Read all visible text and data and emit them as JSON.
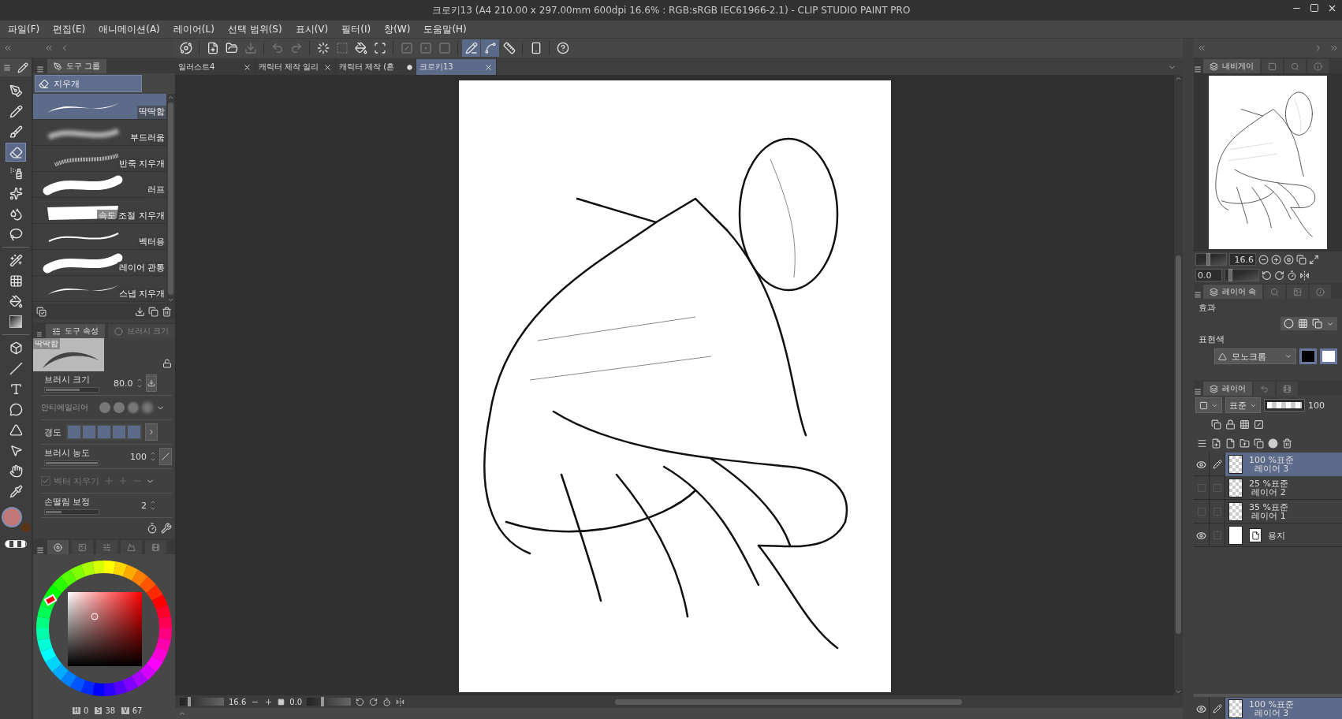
{
  "window": {
    "title": "크로키13 (A4 210.00 x 297.00mm 600dpi 16.6% : RGB:sRGB IEC61966-2.1)  - CLIP STUDIO PAINT PRO"
  },
  "menu": [
    "파일(F)",
    "편집(E)",
    "애니메이션(A)",
    "레이어(L)",
    "선택 범위(S)",
    "표시(V)",
    "필터(I)",
    "창(W)",
    "도움말(H)"
  ],
  "toolbar": [
    {
      "kind": "app",
      "disabled": false,
      "selected": false
    },
    {
      "kind": "new",
      "disabled": false,
      "selected": false
    },
    {
      "kind": "open",
      "disabled": false,
      "selected": false
    },
    {
      "kind": "save",
      "disabled": true,
      "selected": false
    },
    {
      "kind": "undo",
      "disabled": true,
      "selected": false
    },
    {
      "kind": "redo",
      "disabled": true,
      "selected": false
    },
    {
      "kind": "clear",
      "disabled": false,
      "selected": false
    },
    {
      "kind": "outside",
      "disabled": true,
      "selected": false
    },
    {
      "kind": "fill",
      "disabled": false,
      "selected": false
    },
    {
      "kind": "transform",
      "disabled": false,
      "selected": false
    },
    {
      "kind": "hide",
      "disabled": true,
      "selected": false
    },
    {
      "kind": "invert",
      "disabled": true,
      "selected": false
    },
    {
      "kind": "border",
      "disabled": true,
      "selected": false
    },
    {
      "kind": "snap_ruler",
      "disabled": false,
      "selected": true
    },
    {
      "kind": "snap_special",
      "disabled": false,
      "selected": true
    },
    {
      "kind": "snap_grid",
      "disabled": false,
      "selected": false
    },
    {
      "kind": "device",
      "disabled": false,
      "selected": false
    },
    {
      "kind": "help",
      "disabled": false,
      "selected": false
    }
  ],
  "document_tabs": [
    {
      "label": "일러스트4",
      "selected": false,
      "modified": false
    },
    {
      "label": "캐릭터 제작 일리",
      "selected": false,
      "modified": false
    },
    {
      "label": "캐릭터 제작 (혼",
      "selected": false,
      "modified": true
    },
    {
      "label": "크로키13",
      "selected": true,
      "modified": false
    }
  ],
  "tools": [
    {
      "kind": "pen",
      "selected": false
    },
    {
      "kind": "pencil",
      "selected": false
    },
    {
      "kind": "brush",
      "selected": false
    },
    {
      "kind": "eraser",
      "selected": true
    },
    {
      "kind": "airbrush",
      "selected": false
    },
    {
      "kind": "decoration",
      "selected": false
    },
    {
      "kind": "blend",
      "selected": false
    },
    {
      "kind": "lasso",
      "selected": false
    },
    {
      "kind": "wand",
      "selected": false
    },
    {
      "kind": "grid",
      "selected": false
    },
    {
      "kind": "fill",
      "selected": false
    },
    {
      "kind": "gradient",
      "selected": false
    },
    {
      "kind": "object",
      "selected": false
    },
    {
      "kind": "line",
      "selected": false
    },
    {
      "kind": "text",
      "selected": false
    },
    {
      "kind": "balloon",
      "selected": false
    },
    {
      "kind": "ruler",
      "selected": false
    },
    {
      "kind": "correct",
      "selected": false
    },
    {
      "kind": "hand",
      "selected": false
    },
    {
      "kind": "eyedropper",
      "selected": false
    }
  ],
  "swatches": [
    {
      "kind": "main",
      "color": "#c07878"
    },
    {
      "kind": "sub",
      "color": "#5b3418"
    }
  ],
  "sub_tool": {
    "tabs": [
      {
        "kind": "tool_group",
        "label": "도구 그룹",
        "selected": true
      }
    ],
    "group": "지우개",
    "brushes": [
      {
        "label": "딱딱함",
        "kind": "taper",
        "selected": true
      },
      {
        "label": "부드러움",
        "kind": "soft",
        "selected": false
      },
      {
        "label": "반죽 지우개",
        "kind": "spray",
        "selected": false
      },
      {
        "label": "러프",
        "kind": "thick",
        "selected": false
      },
      {
        "label": "속도 조절 지우개",
        "kind": "blob",
        "selected": false
      },
      {
        "label": "벡터용",
        "kind": "thin",
        "selected": false
      },
      {
        "label": "레이어 관통",
        "kind": "thick",
        "selected": false
      },
      {
        "label": "스냅 지우개",
        "kind": "taper",
        "selected": false
      }
    ]
  },
  "tool_property": {
    "tabs": [
      {
        "kind": "tool_property",
        "label": "도구 속성",
        "selected": true
      },
      {
        "kind": "brush_size",
        "label": "브러시 크기",
        "selected": false
      }
    ],
    "preview": "딱딱함",
    "items": [
      {
        "kind": "slider",
        "label": "브러시 크기",
        "value": "80.0",
        "level": 0.65,
        "disabled": false
      },
      {
        "kind": "antialias",
        "label": "안티에일리어",
        "disabled": true
      },
      {
        "kind": "hardness",
        "label": "경도",
        "level": 1,
        "disabled": false
      },
      {
        "kind": "slider",
        "label": "브러시 농도",
        "value": "100",
        "level": 1,
        "disabled": false
      },
      {
        "kind": "check",
        "label": "벡터 지우기",
        "checked": true,
        "disabled": true
      },
      {
        "kind": "slider",
        "label": "손떨림 보정",
        "value": "2",
        "level": 0.3,
        "disabled": false
      }
    ]
  },
  "color_panel": {
    "tabs": [
      {
        "kind": "wheel",
        "selected": true
      },
      {
        "kind": "set",
        "selected": false
      },
      {
        "kind": "sliders",
        "selected": false
      },
      {
        "kind": "mountain",
        "selected": false
      },
      {
        "kind": "film",
        "selected": false
      }
    ],
    "hsv": [
      {
        "label": "H",
        "value": "0"
      },
      {
        "label": "S",
        "value": "38"
      },
      {
        "label": "V",
        "value": "67"
      }
    ]
  },
  "navigator": {
    "tabs": [
      {
        "kind": "navigator",
        "label": "내비게이",
        "selected": true
      },
      {
        "kind": "subview",
        "selected": false
      },
      {
        "kind": "search",
        "selected": false
      },
      {
        "kind": "info",
        "selected": false
      }
    ],
    "sliders": [
      {
        "kind": "zoom",
        "value": "16.6",
        "level": 0.38
      },
      {
        "kind": "rotate",
        "value": "0.0",
        "level": 0.1
      }
    ]
  },
  "layer_property": {
    "tabs": [
      {
        "kind": "layer_property",
        "label": "레이어 속",
        "selected": true
      },
      {
        "kind": "search",
        "selected": false
      },
      {
        "kind": "material",
        "selected": false
      },
      {
        "kind": "info",
        "selected": false
      }
    ],
    "effect": "효과",
    "expression": "표현색",
    "mode": "모노크롬"
  },
  "layer_panel": {
    "tabs": [
      {
        "kind": "layer",
        "label": "레이어",
        "selected": true
      },
      {
        "kind": "history",
        "selected": false
      },
      {
        "kind": "animation",
        "selected": false
      }
    ],
    "blend": "표준",
    "opacity": {
      "value": "100",
      "level": 1
    },
    "layers": [
      {
        "kind": "raster",
        "mode": "100 %표준",
        "name": "레이어 3",
        "visible": true,
        "editing": true,
        "selected": true
      },
      {
        "kind": "raster",
        "mode": "25 %표준",
        "name": "레이어 2",
        "visible": false,
        "editing": false,
        "selected": false
      },
      {
        "kind": "raster",
        "mode": "35 %표준",
        "name": "레이어 1",
        "visible": false,
        "editing": false,
        "selected": false
      },
      {
        "kind": "paper",
        "name": "용지",
        "visible": true,
        "editing": false,
        "selected": false
      }
    ],
    "footer": {
      "mode": "100 %표준",
      "name": "레이어 3"
    }
  },
  "status_bar": {
    "zoom": {
      "value": "16.6",
      "level": 0.2
    },
    "rotation": {
      "value": "0.0",
      "level": 0.35
    }
  }
}
